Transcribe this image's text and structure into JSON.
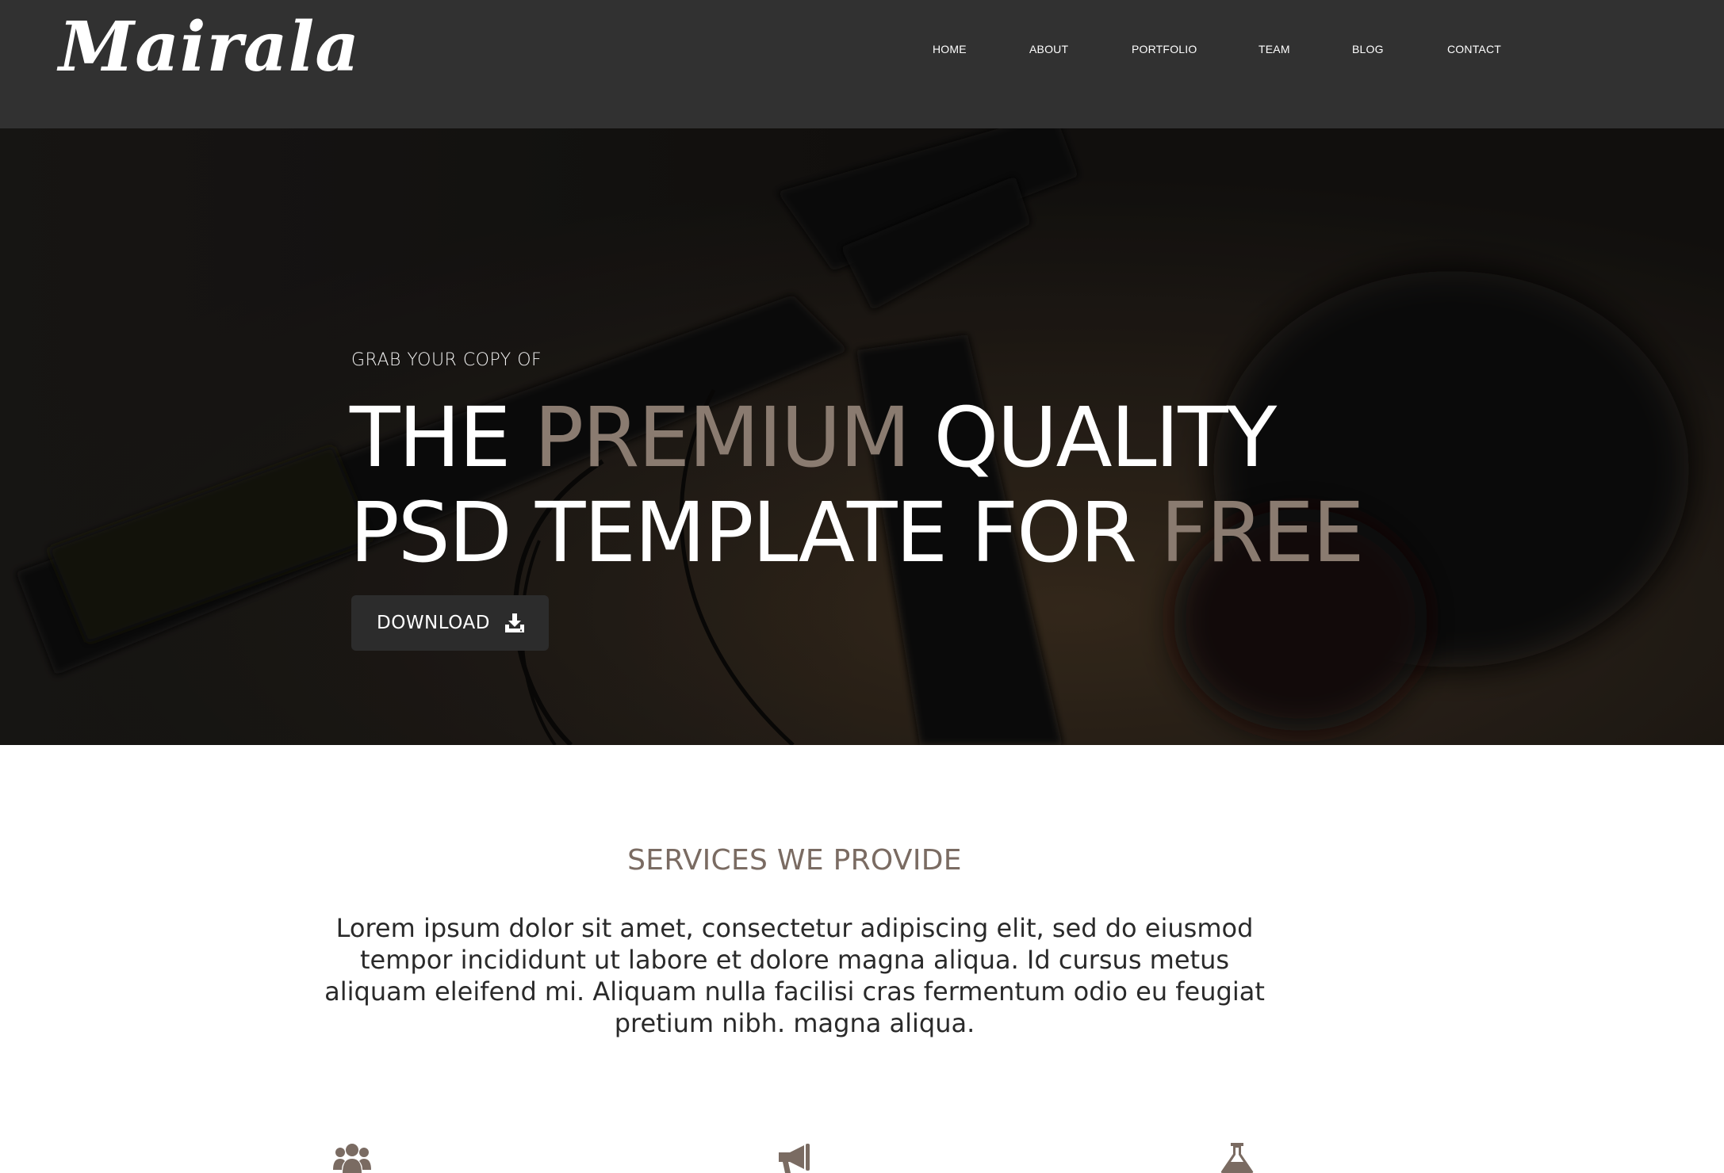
{
  "brand": {
    "logo_text": "Mairala"
  },
  "nav": {
    "items": [
      {
        "label": "HOME"
      },
      {
        "label": "ABOUT"
      },
      {
        "label": "PORTFOLIO"
      },
      {
        "label": "TEAM"
      },
      {
        "label": "BLOG"
      },
      {
        "label": "CONTACT"
      }
    ]
  },
  "hero": {
    "kicker": "GRAB YOUR COPY OF",
    "title_line1": {
      "part1": "THE ",
      "accent": "PREMIUM",
      "part2": " QUALITY"
    },
    "title_line2": {
      "part1": "PSD TEMPLATE FOR ",
      "accent": "FREE"
    },
    "download_label": "DOWNLOAD",
    "download_icon": "download-icon"
  },
  "services": {
    "title": "SERVICES WE PROVIDE",
    "description": "Lorem ipsum dolor sit amet, consectetur adipiscing elit, sed do eiusmod tempor incididunt ut labore et dolore magna aliqua. Id cursus metus aliquam eleifend mi. Aliquam nulla facilisi cras fermentum odio eu feugiat pretium nibh. magna aliqua.",
    "icons": [
      "users-icon",
      "megaphone-icon",
      "flask-icon"
    ]
  },
  "colors": {
    "header_bg": "#313131",
    "accent": "#7a6b62",
    "hero_accent": "#8a7b70",
    "button_bg": "#2c2c2c"
  }
}
